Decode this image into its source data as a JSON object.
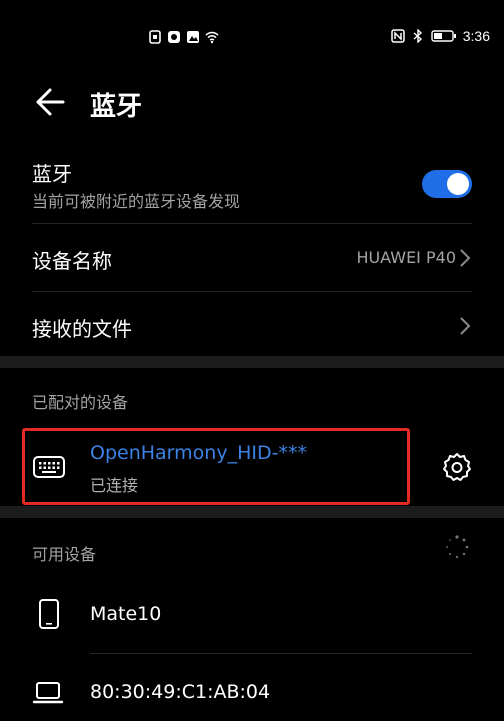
{
  "status_bar": {
    "time": "3:36",
    "left_icons": [
      "sim-card-icon",
      "app-notification-icon",
      "photo-notification-icon",
      "wifi-icon"
    ],
    "right_icons": [
      "nfc-icon",
      "bluetooth-icon",
      "battery-icon"
    ]
  },
  "header": {
    "title": "蓝牙",
    "back_icon": "arrow-left-icon"
  },
  "bluetooth": {
    "label": "蓝牙",
    "subtitle": "当前可被附近的蓝牙设备发现",
    "enabled": true,
    "accent_color": "#1f6ee8"
  },
  "device_name": {
    "label": "设备名称",
    "value": "HUAWEI P40"
  },
  "received_files": {
    "label": "接收的文件"
  },
  "paired_section": {
    "title": "已配对的设备",
    "devices": [
      {
        "name": "OpenHarmony_HID-***",
        "status": "已连接",
        "icon": "keyboard-icon",
        "name_color": "#3b82e4"
      }
    ],
    "highlight_color": "#e42b22"
  },
  "available_section": {
    "title": "可用设备",
    "devices": [
      {
        "name": "Mate10",
        "icon": "phone-icon"
      },
      {
        "name": "80:30:49:C1:AB:04",
        "icon": "laptop-icon"
      }
    ]
  }
}
